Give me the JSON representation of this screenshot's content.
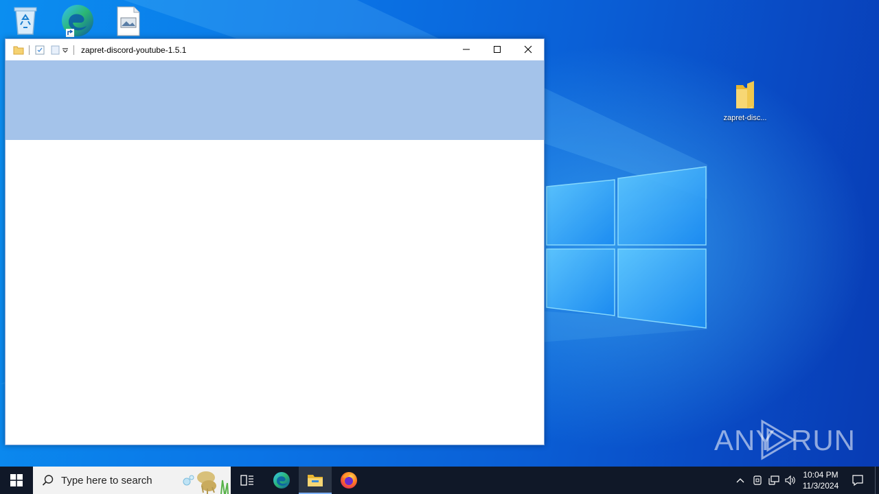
{
  "desktop": {
    "icons": [
      {
        "name": "recycle-bin",
        "label": ""
      },
      {
        "name": "microsoft-edge",
        "label": ""
      },
      {
        "name": "image-file",
        "label": ""
      },
      {
        "name": "zapret-folder",
        "label": "zapret-disc..."
      }
    ],
    "watermark": {
      "left": "ANY",
      "right": "RUN"
    }
  },
  "window": {
    "title": "zapret-discord-youtube-1.5.1",
    "ribbon_color": "#a4c3ea"
  },
  "taskbar": {
    "search_placeholder": "Type here to search",
    "clock_time": "10:04 PM",
    "clock_date": "11/3/2024",
    "apps": [
      "task-view",
      "microsoft-edge",
      "file-explorer",
      "firefox"
    ],
    "active_app": "file-explorer"
  },
  "colors": {
    "taskbar_bg": "#101828",
    "accent": "#0a74e6"
  }
}
